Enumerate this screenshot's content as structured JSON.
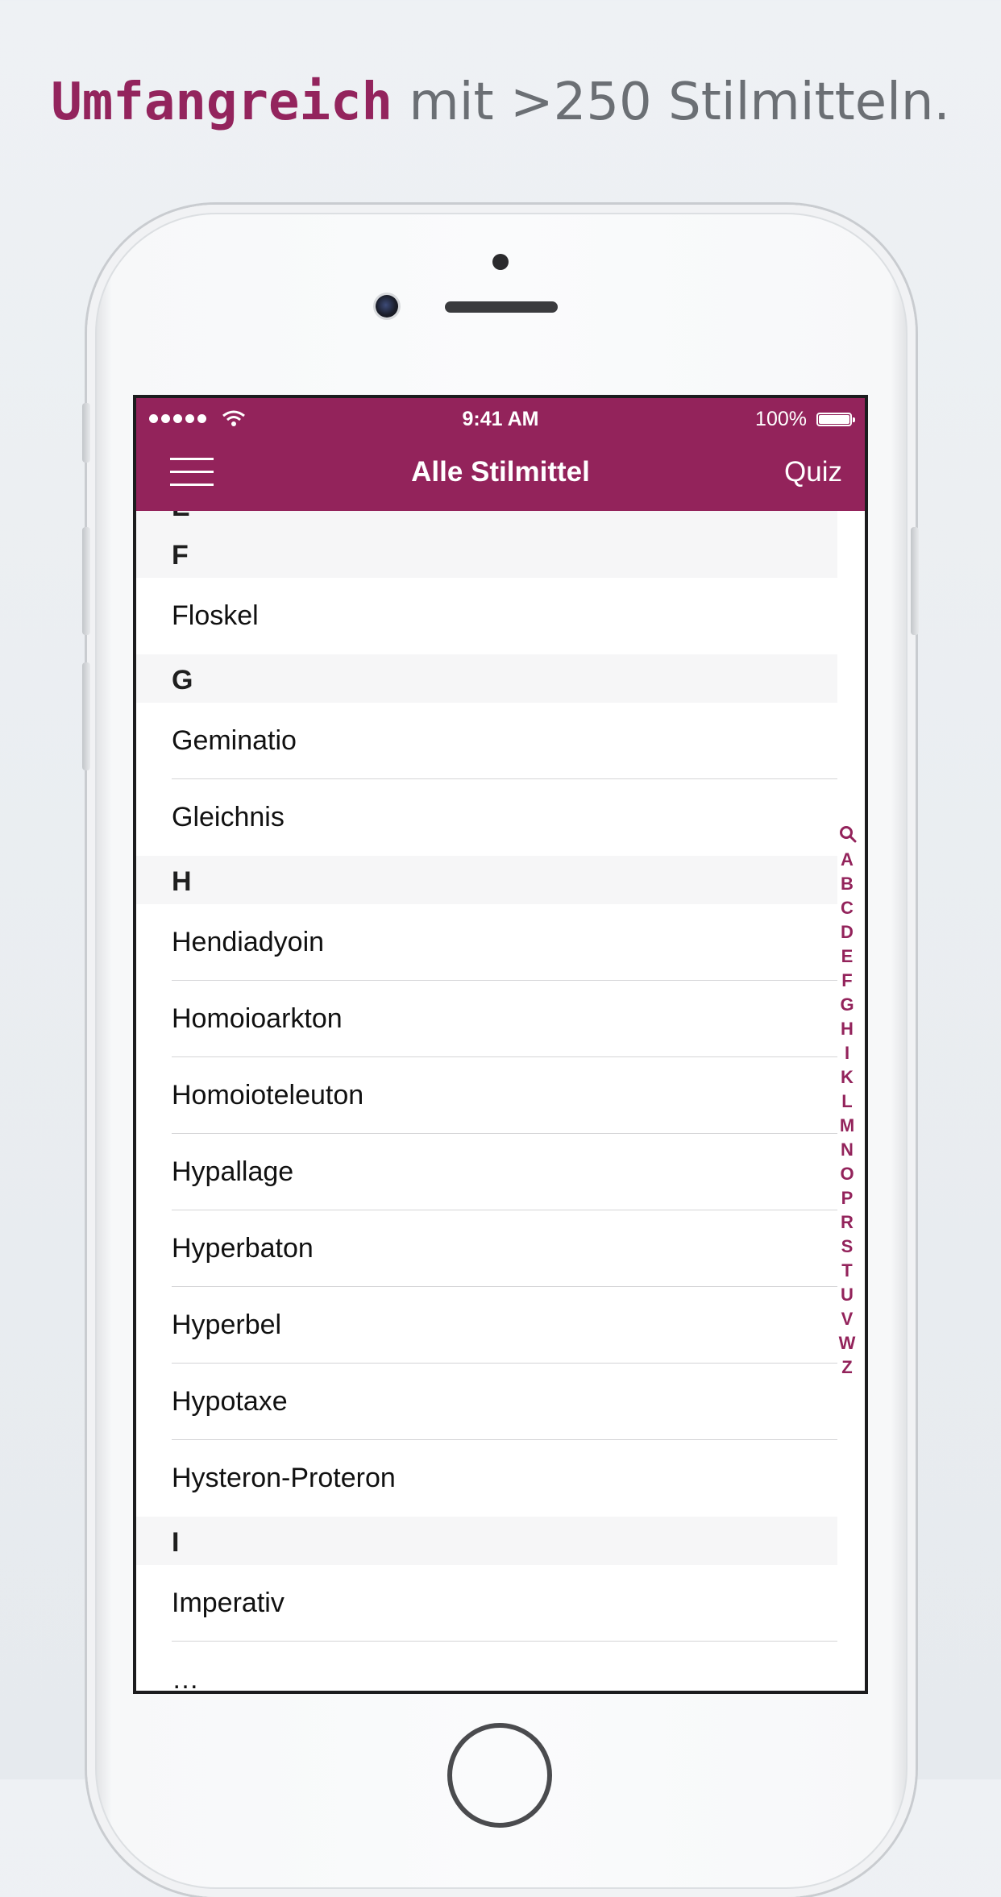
{
  "headline": {
    "bold": "Umfangreich",
    "rest": " mit >250 Stilmitteln."
  },
  "status_bar": {
    "time": "9:41 AM",
    "battery": "100%",
    "signal_icon": "signal-dots-icon",
    "wifi_icon": "wifi-icon",
    "battery_icon": "battery-icon"
  },
  "nav": {
    "title": "Alle Stilmittel",
    "menu_icon": "hamburger-menu-icon",
    "quiz_label": "Quiz"
  },
  "list": {
    "partial_header": "E",
    "partial_last_item": "Imperativ",
    "sections": [
      {
        "letter": "F",
        "items": [
          "Floskel"
        ]
      },
      {
        "letter": "G",
        "items": [
          "Geminatio",
          "Gleichnis"
        ]
      },
      {
        "letter": "H",
        "items": [
          "Hendiadyoin",
          "Homoioarkton",
          "Homoioteleuton",
          "Hypallage",
          "Hyperbaton",
          "Hyperbel",
          "Hypotaxe",
          "Hysteron-Proteron"
        ]
      },
      {
        "letter": "I",
        "items": [
          "Imperativ"
        ]
      }
    ]
  },
  "section_index": {
    "search_icon": "search-icon",
    "letters": [
      "A",
      "B",
      "C",
      "D",
      "E",
      "F",
      "G",
      "H",
      "I",
      "K",
      "L",
      "M",
      "N",
      "O",
      "P",
      "R",
      "S",
      "T",
      "U",
      "V",
      "W",
      "Z"
    ]
  },
  "colors": {
    "accent": "#93235b",
    "header_bg": "#f6f6f7",
    "page_bg": "#eef1f4"
  }
}
